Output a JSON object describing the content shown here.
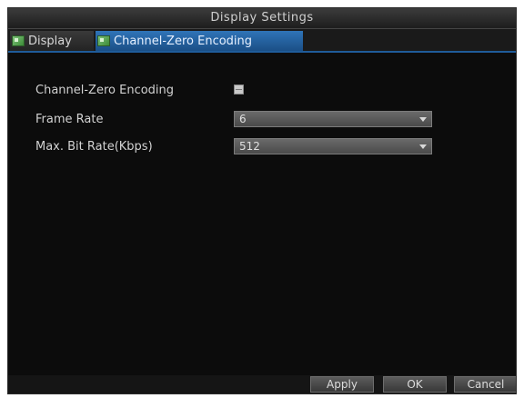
{
  "window": {
    "title": "Display Settings"
  },
  "tabs": [
    {
      "label": "Display",
      "icon": "display-icon",
      "active": false
    },
    {
      "label": "Channel-Zero Encoding",
      "icon": "channel-zero-icon",
      "active": true
    }
  ],
  "form": {
    "channel_zero_label": "Channel-Zero Encoding",
    "channel_zero_checked": false,
    "frame_rate_label": "Frame Rate",
    "frame_rate_value": "6",
    "max_bitrate_label": "Max. Bit Rate(Kbps)",
    "max_bitrate_value": "512"
  },
  "buttons": {
    "apply": "Apply",
    "ok": "OK",
    "cancel": "Cancel"
  },
  "colors": {
    "background": "#0c0c0c",
    "active_tab": "#2f74b8",
    "tab_underline": "#1f5c9a"
  }
}
